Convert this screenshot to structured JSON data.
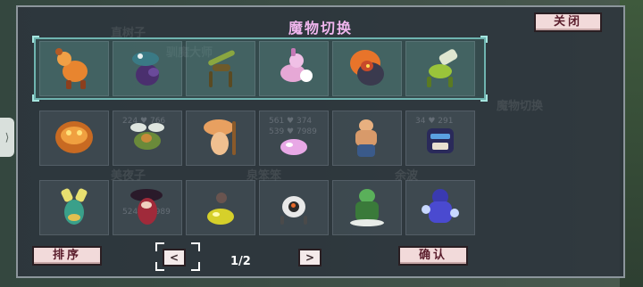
{
  "dialog": {
    "title": "魔物切换",
    "close_label": "关闭",
    "sort_label": "排序",
    "confirm_label": "确认",
    "prev_label": "<",
    "next_label": ">",
    "page_indicator": "1/2"
  },
  "team": [
    {
      "name": "orange-goat"
    },
    {
      "name": "purple-serpent"
    },
    {
      "name": "stick-mantis"
    },
    {
      "name": "pink-fox"
    },
    {
      "name": "fire-maned-beast"
    },
    {
      "name": "green-cannon-bug"
    }
  ],
  "bench": [
    {
      "name": "magma-golem"
    },
    {
      "name": "winged-turtle"
    },
    {
      "name": "mushroom-caveman"
    },
    {
      "name": "pink-slime"
    },
    {
      "name": "cat-brawler"
    },
    {
      "name": "treasure-chest-mimic"
    },
    {
      "name": "leaf-duck"
    },
    {
      "name": "red-witch"
    },
    {
      "name": "yellow-slime"
    },
    {
      "name": "eyeball-spider"
    },
    {
      "name": "green-goblin"
    },
    {
      "name": "blue-spirit"
    }
  ],
  "ghost_text": {
    "bg_name_1": "直树子",
    "bg_name_2": "驯魔大师",
    "bg_name_3": "魔物切换",
    "bg_name_4": "美夜子",
    "bg_name_5": "泉笨笨",
    "bg_name_6": "余波",
    "stat_a": "224 ♥ 766",
    "stat_b": "539 ♥ 7989",
    "stat_c": "524 ♥ 7989",
    "stat_d": "561 ♥ 374",
    "stat_e": "34 ♥ 291"
  }
}
